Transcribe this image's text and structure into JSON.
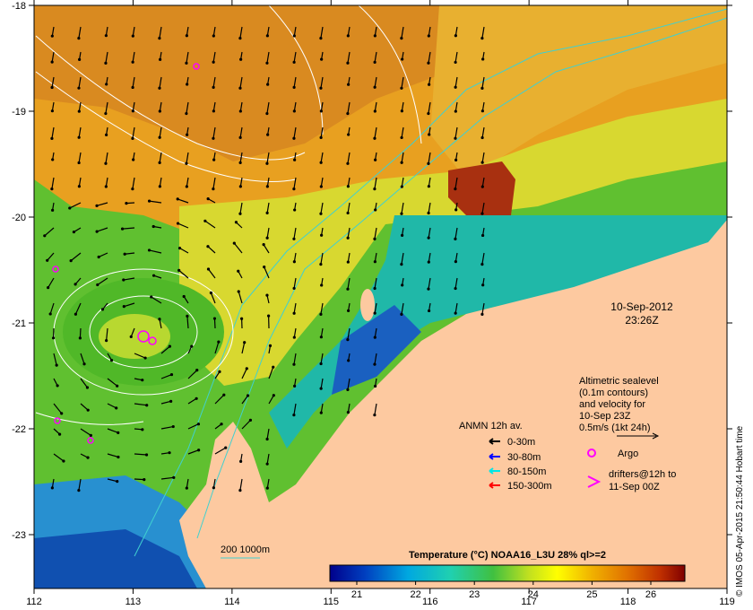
{
  "map": {
    "lon_ticks": [
      "112",
      "113",
      "114",
      "115",
      "116",
      "117",
      "118",
      "119"
    ],
    "lat_ticks": [
      "-18",
      "-19",
      "-20",
      "-21",
      "-22",
      "-23"
    ],
    "timestamp": {
      "date": "10-Sep-2012",
      "time": "23:26Z"
    },
    "altimetry_note": {
      "lines": [
        "Altimetric sealevel",
        "(0.1m contours)",
        "and velocity for",
        "10-Sep 23Z",
        "0.5m/s (1kt 24h)"
      ]
    },
    "legend": {
      "title": "ANMN 12h av.",
      "items": [
        {
          "label": "0-30m",
          "color": "#000000"
        },
        {
          "label": "30-80m",
          "color": "#0000ff"
        },
        {
          "label": "80-150m",
          "color": "#00e6e6"
        },
        {
          "label": "150-300m",
          "color": "#ff0000"
        }
      ],
      "argo_label": "Argo",
      "drifters_label_1": "drifters@12h to",
      "drifters_label_2": "11-Sep 00Z",
      "marker_color": "#ff00ff"
    },
    "depth_legend": "200  1000m",
    "colorbar": {
      "title": "Temperature (°C) NOAA16_L3U 28% ql>=2",
      "ticks": [
        "21",
        "22",
        "23",
        "24",
        "25",
        "26"
      ]
    },
    "credit": "© IMOS 05-Apr-2015 21:50:44 Hobart time",
    "colors": {
      "land": "#fdc9a0",
      "contour": "#ffffff",
      "isobath": "#40d0d0"
    }
  }
}
